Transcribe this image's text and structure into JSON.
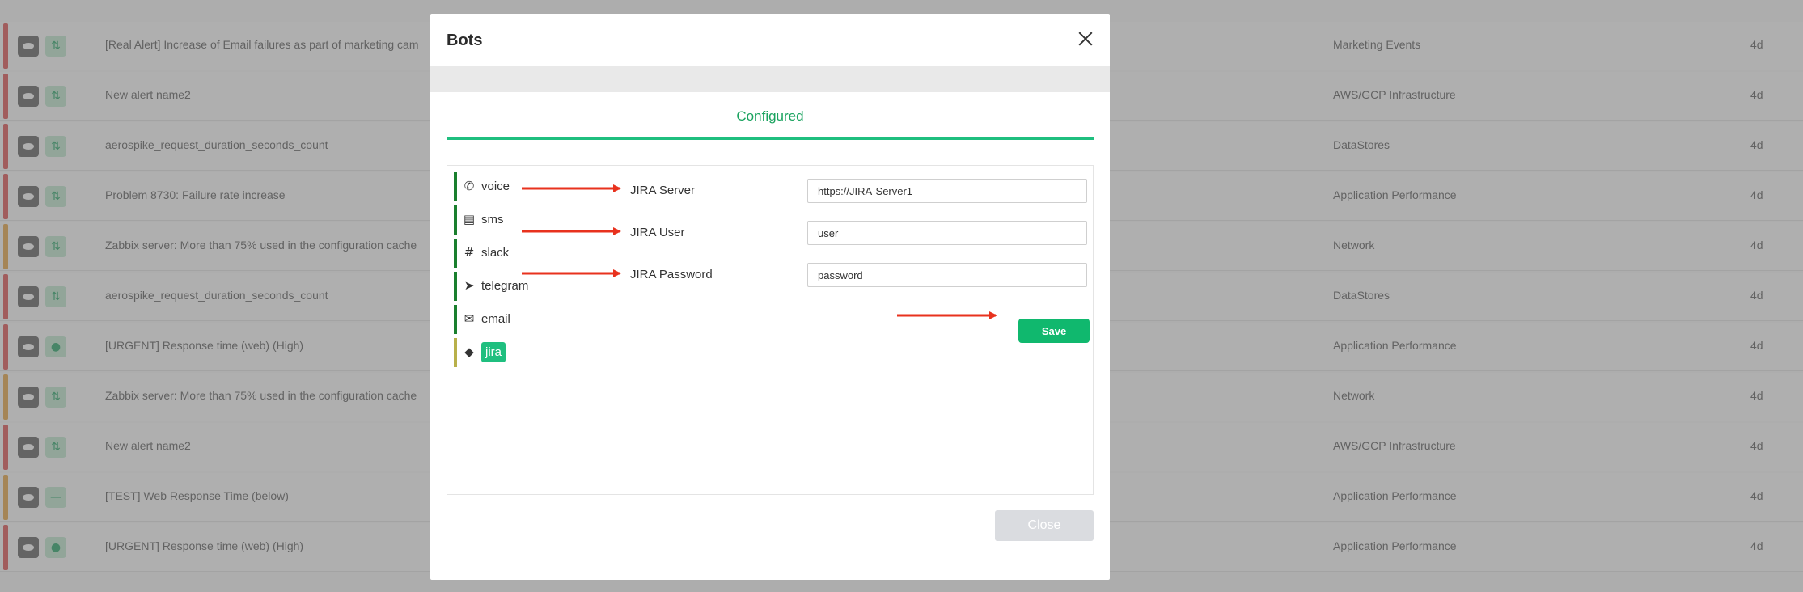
{
  "background": {
    "rows": [
      {
        "name": "[Real Alert] Increase of Email failures as part of marketing cam",
        "category": "Marketing Events",
        "age": "4d",
        "severity": "#e04a4a",
        "ack": "⇅"
      },
      {
        "name": "New alert name2",
        "category": "AWS/GCP Infrastructure",
        "age": "4d",
        "severity": "#e04a4a",
        "ack": "⇅"
      },
      {
        "name": "aerospike_request_duration_seconds_count",
        "category": "DataStores",
        "age": "4d",
        "severity": "#e04a4a",
        "ack": "⇅"
      },
      {
        "name": "Problem 8730: Failure rate increase",
        "category": "Application Performance",
        "age": "4d",
        "severity": "#e04a4a",
        "ack": "⇅"
      },
      {
        "name": "Zabbix server: More than 75% used in the configuration cache",
        "category": "Network",
        "age": "4d",
        "severity": "#e8a33a",
        "ack": "⇅"
      },
      {
        "name": "aerospike_request_duration_seconds_count",
        "category": "DataStores",
        "age": "4d",
        "severity": "#e04a4a",
        "ack": "⇅"
      },
      {
        "name": "[URGENT] Response time (web) (High)",
        "category": "Application Performance",
        "age": "4d",
        "severity": "#e04a4a",
        "ack": "●"
      },
      {
        "name": "Zabbix server: More than 75% used in the configuration cache",
        "category": "Network",
        "age": "4d",
        "severity": "#e8a33a",
        "ack": "⇅"
      },
      {
        "name": "New alert name2",
        "category": "AWS/GCP Infrastructure",
        "age": "4d",
        "severity": "#e04a4a",
        "ack": "⇅"
      },
      {
        "name": "[TEST] Web Response Time (below)",
        "category": "Application Performance",
        "age": "4d",
        "severity": "#e8a33a",
        "ack": "—"
      },
      {
        "name": "[URGENT] Response time (web) (High)",
        "category": "Application Performance",
        "age": "4d",
        "severity": "#e04a4a",
        "ack": "●"
      }
    ]
  },
  "modal": {
    "title": "Bots",
    "tab": "Configured",
    "bots": [
      {
        "label": "voice",
        "icon": "phone-icon",
        "glyph": "✆"
      },
      {
        "label": "sms",
        "icon": "message-icon",
        "glyph": "▤"
      },
      {
        "label": "slack",
        "icon": "slack-icon",
        "glyph": "#"
      },
      {
        "label": "telegram",
        "icon": "telegram-icon",
        "glyph": "➤"
      },
      {
        "label": "email",
        "icon": "envelope-icon",
        "glyph": "✉"
      },
      {
        "label": "jira",
        "icon": "jira-icon",
        "glyph": "◆"
      }
    ],
    "fields": [
      {
        "label": "JIRA Server",
        "value": "https://JIRA-Server1"
      },
      {
        "label": "JIRA User",
        "value": "user"
      },
      {
        "label": "JIRA Password",
        "value": "password"
      }
    ],
    "save_label": "Save",
    "close_label": "Close"
  },
  "colors": {
    "accent": "#1fbf7f",
    "save": "#10b86e",
    "bot_border": "#1a7f2e",
    "annotation_arrow": "#e8321e"
  }
}
